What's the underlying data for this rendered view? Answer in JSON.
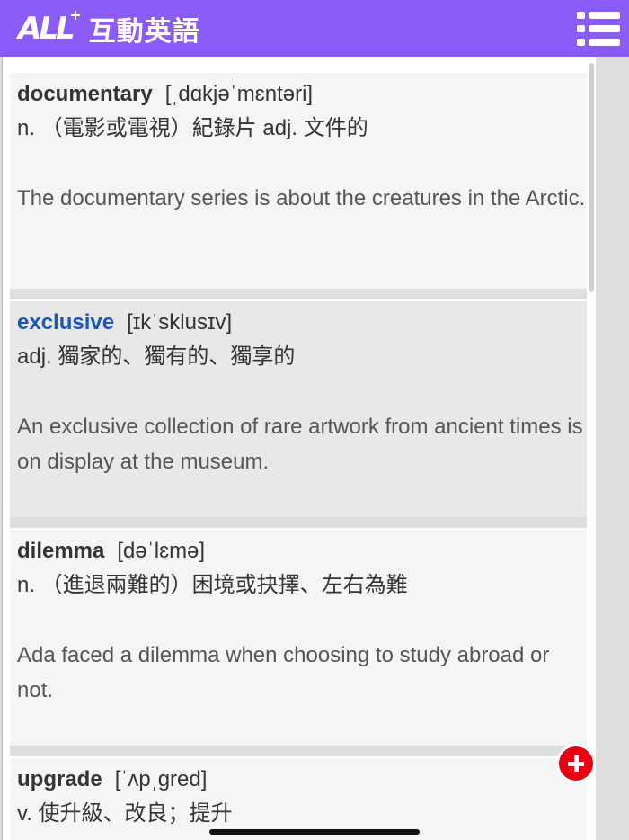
{
  "header": {
    "logo_mark": "ALL",
    "logo_plus": "+",
    "title": "互動英語",
    "menu_icon": "list-menu-icon",
    "background_color": "#8a5cf5"
  },
  "entries": [
    {
      "word": "documentary",
      "ipa": "[ˌdɑkjəˈmɛntəri]",
      "definition": "n. （電影或電視）紀錄片 adj. 文件的",
      "example": "The documentary series is about the creatures in the Arctic."
    },
    {
      "word": "exclusive",
      "ipa": "[ɪkˈsklusɪv]",
      "definition": "adj. 獨家的、獨有的、獨享的",
      "example": "An exclusive collection of rare artwork from ancient times is on display at the museum."
    },
    {
      "word": "dilemma",
      "ipa": "[dəˈlɛmə]",
      "definition": "n. （進退兩難的）困境或抉擇、左右為難",
      "example": "Ada faced a dilemma when choosing to study abroad or not."
    },
    {
      "word": "upgrade",
      "ipa": "[ˈʌpˌgred]",
      "definition": "v. 使升級、改良；提升",
      "example": ""
    }
  ],
  "add_button": {
    "icon": "plus-icon",
    "color": "#e60012"
  },
  "colors": {
    "active_word": "#1a56b8",
    "word": "#333333"
  }
}
